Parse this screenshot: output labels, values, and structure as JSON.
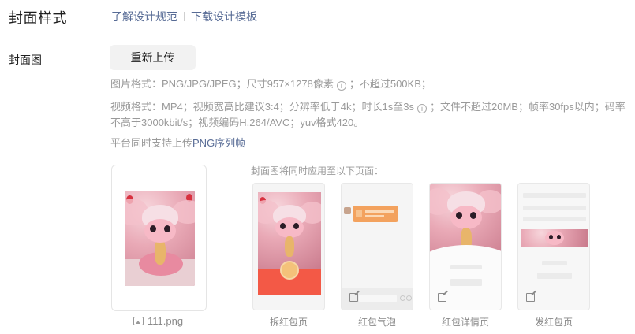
{
  "header": {
    "title": "封面样式",
    "links": [
      {
        "label": "了解设计规范"
      },
      {
        "label": "下载设计模板"
      }
    ]
  },
  "cover": {
    "label": "封面图",
    "reupload_label": "重新上传",
    "hint_image": {
      "before": "图片格式：PNG/JPG/JPEG；尺寸957×1278像素",
      "after": "；不超过500KB；"
    },
    "hint_video": {
      "before": "视频格式：MP4；视频宽高比建议3:4；分辨率低于4k；时长1s至3s",
      "after": "；文件不超过20MB；帧率30fps以内；码率不高于3000kbit/s；视频编码H.264/AVC；yuv格式420。"
    },
    "hint_sequence": {
      "before": "平台同时支持上传",
      "link": "PNG序列帧"
    },
    "file_name": "111.png",
    "info_glyph": "i"
  },
  "apply": {
    "title": "封面图将同时应用至以下页面：",
    "pages": [
      {
        "label": "拆红包页"
      },
      {
        "label": "红包气泡"
      },
      {
        "label": "红包详情页"
      },
      {
        "label": "发红包页"
      }
    ]
  },
  "icons": [
    "info-icon",
    "image-icon",
    "edit-icon"
  ],
  "colors": {
    "link": "#576b95",
    "hint": "#9a9a9a",
    "red_envelope": "#f35946",
    "bubble": "#f3a25e"
  }
}
